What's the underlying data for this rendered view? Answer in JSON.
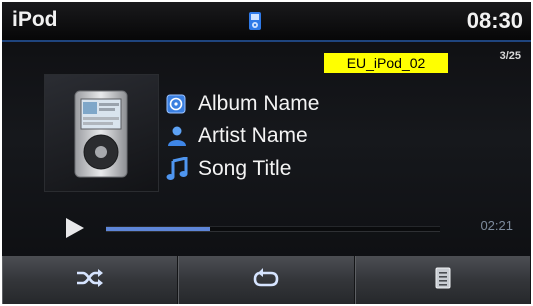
{
  "status_bar": {
    "title": "iPod",
    "time": "08:30",
    "source_icon": "ipod-device-icon",
    "accent_color": "#2b6fd6"
  },
  "reference_label": "EU_iPod_02",
  "track_count": "3/25",
  "album_art_icon": "ipod-classic-icon",
  "metadata": {
    "album": {
      "icon": "album-icon",
      "text": "Album Name"
    },
    "artist": {
      "icon": "artist-icon",
      "text": "Artist Name"
    },
    "song": {
      "icon": "music-note-icon",
      "text": "Song Title"
    }
  },
  "playback": {
    "state_icon": "play-icon",
    "elapsed": "02:21",
    "progress": 0.31
  },
  "buttons": [
    {
      "name": "shuffle-button",
      "icon": "shuffle-icon"
    },
    {
      "name": "repeat-button",
      "icon": "repeat-icon"
    },
    {
      "name": "list-button",
      "icon": "list-icon"
    }
  ]
}
